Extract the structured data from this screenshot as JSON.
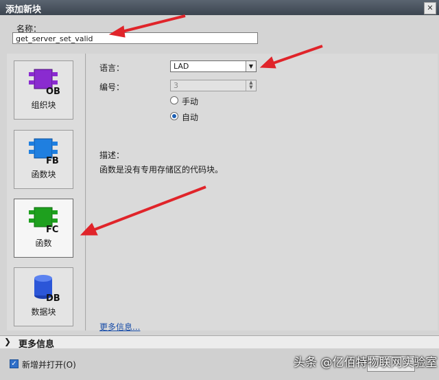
{
  "window": {
    "title": "添加新块",
    "close_icon": "close-icon"
  },
  "name_field": {
    "label": "名称：",
    "value": "get_server_set_valid"
  },
  "block_types": [
    {
      "label": "组织块",
      "badge": "OB",
      "color": "#8a2bd0",
      "selected": false
    },
    {
      "label": "函数块",
      "badge": "FB",
      "color": "#1f7fe0",
      "selected": false
    },
    {
      "label": "函数",
      "badge": "FC",
      "color": "#1ea01e",
      "selected": true
    },
    {
      "label": "数据块",
      "badge": "DB",
      "color": "#2b56d8",
      "selected": false
    }
  ],
  "settings": {
    "language_label": "语言：",
    "language_value": "LAD",
    "number_label": "编号：",
    "number_value": "3",
    "manual_label": "手动",
    "auto_label": "自动",
    "auto_selected": true
  },
  "description": {
    "label": "描述：",
    "text": "函数是没有专用存储区的代码块。"
  },
  "more_info_link": "更多信息...",
  "more_info_bar": "更多信息",
  "footer": {
    "add_open_label": "新增并打开(O)",
    "add_open_checked": true
  },
  "watermark": "头条 @亿佰特物联网实验室",
  "colors": {
    "titlebar": "#3c4550",
    "arrow": "#e0242a",
    "link": "#1a4ea8"
  }
}
